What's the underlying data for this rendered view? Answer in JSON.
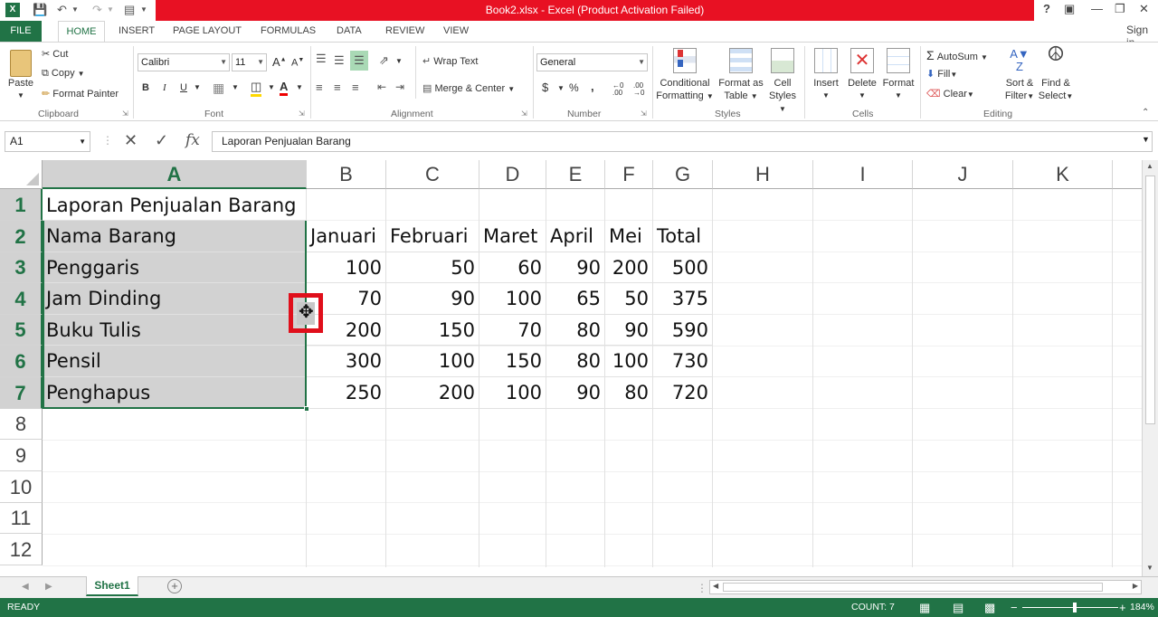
{
  "window": {
    "title": "Book2.xlsx -  Excel (Product Activation Failed)",
    "help": "?",
    "sign_in": "Sign in"
  },
  "tabs": [
    "FILE",
    "HOME",
    "INSERT",
    "PAGE LAYOUT",
    "FORMULAS",
    "DATA",
    "REVIEW",
    "VIEW"
  ],
  "ribbon": {
    "clipboard": {
      "paste": "Paste",
      "cut": "Cut",
      "copy": "Copy",
      "format_painter": "Format Painter",
      "label": "Clipboard"
    },
    "font": {
      "name": "Calibri",
      "size": "11",
      "bold": "B",
      "italic": "I",
      "underline": "U",
      "label": "Font"
    },
    "alignment": {
      "wrap_text": "Wrap Text",
      "merge_center": "Merge & Center",
      "label": "Alignment"
    },
    "number": {
      "format": "General",
      "currency": "$",
      "percent": "%",
      "comma": ",",
      "label": "Number"
    },
    "styles": {
      "conditional": "Conditional",
      "conditional2": "Formatting",
      "format_as": "Format as",
      "format_as2": "Table",
      "cell": "Cell",
      "cell2": "Styles",
      "label": "Styles"
    },
    "cells": {
      "insert": "Insert",
      "delete": "Delete",
      "format": "Format",
      "label": "Cells"
    },
    "editing": {
      "autosum": "AutoSum",
      "fill": "Fill",
      "clear": "Clear",
      "sort": "Sort &",
      "sort2": "Filter",
      "find": "Find &",
      "find2": "Select",
      "label": "Editing"
    }
  },
  "formula_bar": {
    "name_box": "A1",
    "cancel": "✕",
    "enter": "✓",
    "fx": "fx",
    "content": "Laporan Penjualan Barang"
  },
  "columns": [
    "A",
    "B",
    "C",
    "D",
    "E",
    "F",
    "G",
    "H",
    "I",
    "J",
    "K"
  ],
  "rows": [
    "1",
    "2",
    "3",
    "4",
    "5",
    "6",
    "7",
    "8",
    "9",
    "10",
    "11",
    "12"
  ],
  "cells": {
    "A1": "Laporan Penjualan Barang",
    "A2": "Nama Barang",
    "B2": "Januari",
    "C2": "Februari",
    "D2": "Maret",
    "E2": "April",
    "F2": "Mei",
    "G2": "Total",
    "A3": "Penggaris",
    "B3": "100",
    "C3": "50",
    "D3": "60",
    "E3": "90",
    "F3": "200",
    "G3": "500",
    "A4": "Jam Dinding",
    "B4": "70",
    "C4": "90",
    "D4": "100",
    "E4": "65",
    "F4": "50",
    "G4": "375",
    "A5": "Buku Tulis",
    "B5": "200",
    "C5": "150",
    "D5": "70",
    "E5": "80",
    "F5": "90",
    "G5": "590",
    "A6": "Pensil",
    "B6": "300",
    "C6": "100",
    "D6": "150",
    "E6": "80",
    "F6": "100",
    "G6": "730",
    "A7": "Penghapus",
    "B7": "250",
    "C7": "200",
    "D7": "100",
    "E7": "90",
    "F7": "80",
    "G7": "720"
  },
  "sheet_tabs": {
    "active": "Sheet1"
  },
  "status": {
    "ready": "READY",
    "count": "COUNT: 7",
    "zoom": "184%"
  },
  "colors": {
    "excel_green": "#217346",
    "alert_red": "#e81123"
  }
}
